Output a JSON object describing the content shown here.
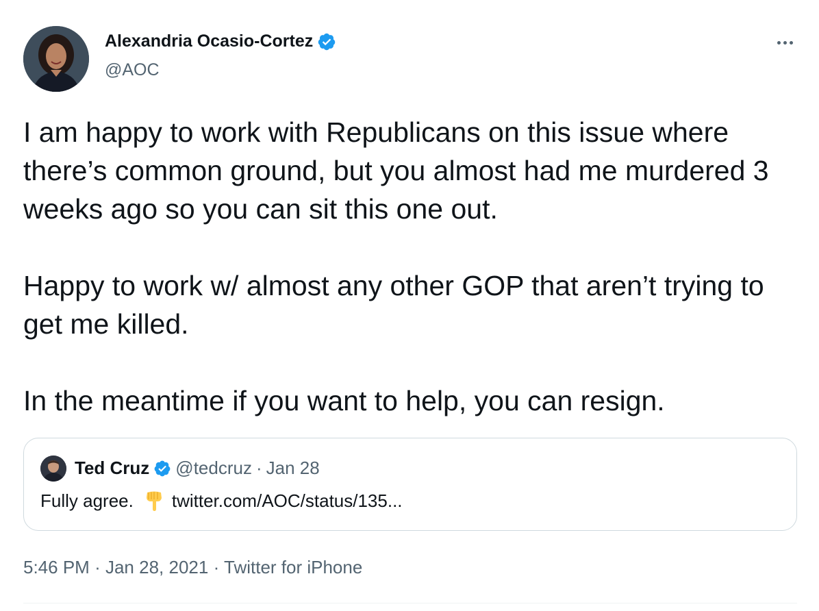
{
  "author": {
    "display_name": "Alexandria Ocasio-Cortez",
    "handle": "@AOC",
    "verified_icon": "verified-badge-icon",
    "avatar_icon": "avatar"
  },
  "tweet": {
    "paragraphs": [
      "I am happy to work with Republicans on this issue where there’s common ground, but you almost had me murdered 3 weeks ago so you can sit this one out.",
      "Happy to work w/ almost any other GOP that aren’t trying to get me killed.",
      "In the meantime if you want to help, you can resign."
    ]
  },
  "quote": {
    "display_name": "Ted Cruz",
    "handle": "@tedcruz",
    "separator": "·",
    "date": "Jan 28",
    "text": "Fully agree.",
    "emoji": "backhand-index-pointing-down",
    "link": "twitter.com/AOC/status/135..."
  },
  "meta": {
    "time": "5:46 PM",
    "separator": "·",
    "date": "Jan 28, 2021",
    "source": "Twitter for iPhone"
  },
  "colors": {
    "text": "#0f1419",
    "secondary": "#536471",
    "verified": "#1d9bf0",
    "border": "#cfd9de"
  }
}
